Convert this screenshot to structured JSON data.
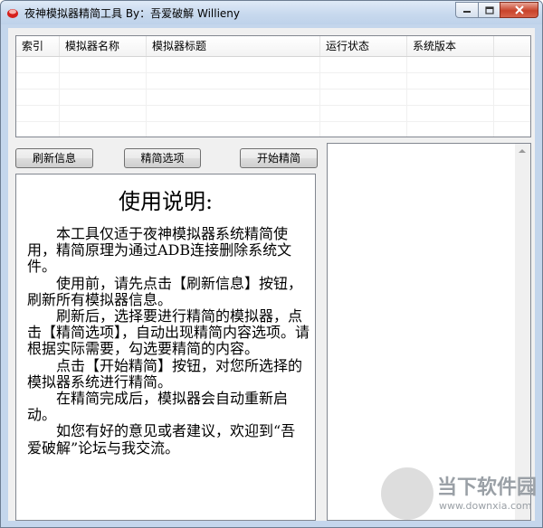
{
  "window": {
    "title": "夜神模拟器精简工具 By：吾爱破解 Willieny"
  },
  "list": {
    "columns": [
      "索引",
      "模拟器名称",
      "模拟器标题",
      "运行状态",
      "系统版本"
    ]
  },
  "buttons": {
    "refresh": "刷新信息",
    "options": "精简选项",
    "start": "开始精简"
  },
  "instructions": {
    "title": "使用说明:",
    "paragraphs": [
      "本工具仅适于夜神模拟器系统精简使用，精简原理为通过ADB连接删除系统文件。",
      "使用前，请先点击【刷新信息】按钮，刷新所有模拟器信息。",
      "刷新后，选择要进行精简的模拟器，点击【精简选项】，自动出现精简内容选项。请根据实际需要，勾选要精简的内容。",
      "点击【开始精简】按钮，对您所选择的模拟器系统进行精简。",
      "在精简完成后，模拟器会自动重新启动。",
      "如您有好的意见或者建议，欢迎到“吾爱破解”论坛与我交流。"
    ]
  },
  "watermark": {
    "name": "当下软件园",
    "url": "www.downxia.com"
  }
}
